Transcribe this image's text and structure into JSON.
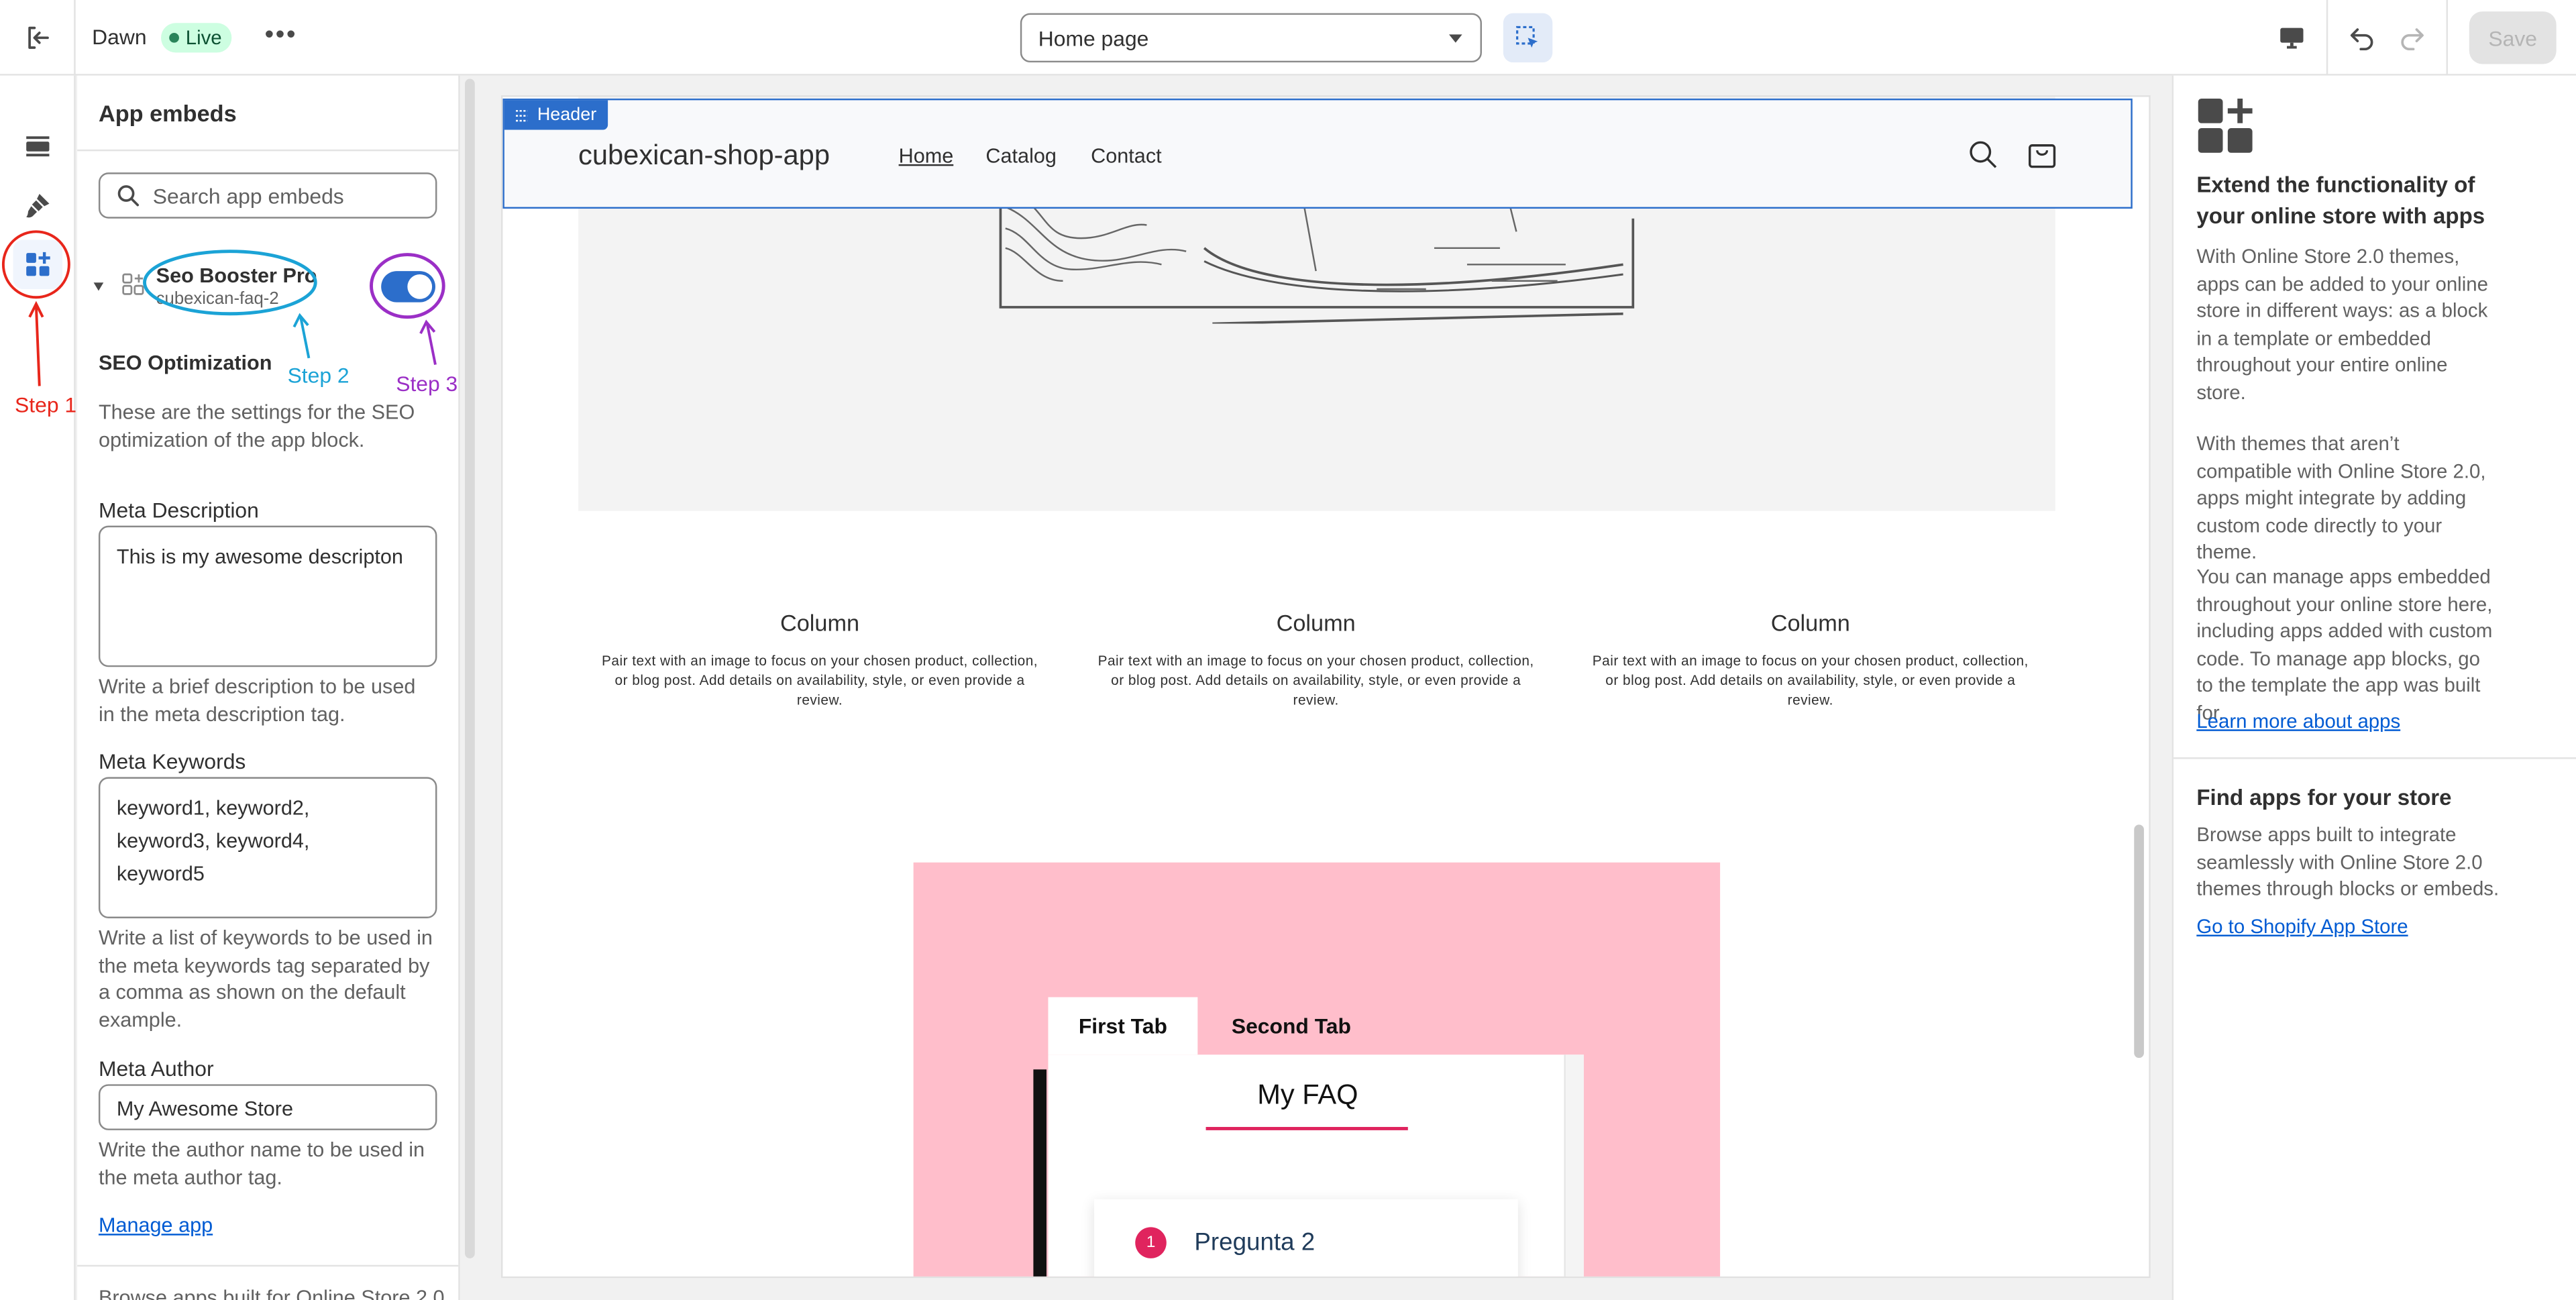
{
  "topbar": {
    "theme_name": "Dawn",
    "live_label": "Live",
    "more_label": "•••",
    "page_select": "Home page",
    "save_label": "Save"
  },
  "left_panel": {
    "title": "App embeds",
    "search_placeholder": "Search app embeds",
    "embed": {
      "name": "Seo Booster Pro",
      "handle": "cubexican-faq-2",
      "enabled": true
    },
    "section_title": "SEO Optimization",
    "section_description": "These are the settings for the SEO optimization of the app block.",
    "meta_description": {
      "label": "Meta Description",
      "value": "This is my awesome descripton",
      "help": "Write a brief description to be used in the meta description tag."
    },
    "meta_keywords": {
      "label": "Meta Keywords",
      "value": "keyword1, keyword2, keyword3, keyword4, keyword5",
      "help": "Write a list of keywords to be used in the meta keywords tag separated by a comma as shown on the default example."
    },
    "meta_author": {
      "label": "Meta Author",
      "value": "My Awesome Store",
      "help": "Write the author name to be used in the meta author tag."
    },
    "manage_link": "Manage app",
    "footer_text": "Browse apps built for Online Store 2.0"
  },
  "preview": {
    "header_tag": "Header",
    "brand": "cubexican-shop-app",
    "nav": [
      "Home",
      "Catalog",
      "Contact"
    ],
    "columns": [
      {
        "title": "Column",
        "text": "Pair text with an image to focus on your chosen product, collection, or blog post. Add details on availability, style, or even provide a review."
      },
      {
        "title": "Column",
        "text": "Pair text with an image to focus on your chosen product, collection, or blog post. Add details on availability, style, or even provide a review."
      },
      {
        "title": "Column",
        "text": "Pair text with an image to focus on your chosen product, collection, or blog post. Add details on availability, style, or even provide a review."
      }
    ],
    "faq": {
      "tabs": [
        "First Tab",
        "Second Tab"
      ],
      "title": "My FAQ",
      "question_number": "1",
      "question": "Pregunta 2"
    }
  },
  "right_panel": {
    "heading": "Extend the functionality of your online store with apps",
    "para1": "With Online Store 2.0 themes, apps can be added to your online store in different ways: as a block in a template or embedded throughout your entire online store.",
    "para2": "With themes that aren’t compatible with Online Store 2.0, apps might integrate by adding custom code directly to your theme.",
    "para3": "You can manage apps embedded throughout your online store here, including apps added with custom code. To manage app blocks, go to the template the app was built for.",
    "learn_link": "Learn more about apps",
    "find_heading": "Find apps for your store",
    "find_text": "Browse apps built to integrate seamlessly with Online Store 2.0 themes through blocks or embeds.",
    "store_link": "Go to Shopify App Store"
  },
  "annotations": {
    "step1": "Step 1",
    "step2": "Step 2",
    "step3": "Step 3",
    "colors": {
      "step1": "#e8261b",
      "step2": "#1ba3d6",
      "step3": "#9b2fc6"
    }
  }
}
